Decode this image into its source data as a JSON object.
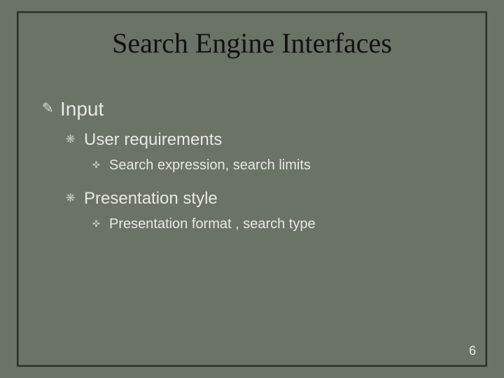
{
  "title": "Search Engine Interfaces",
  "bullets": {
    "lvl1_icon": "✎",
    "lvl2_icon": "❋",
    "lvl3_icon": "✜",
    "input": "Input",
    "user_req": "User requirements",
    "user_req_detail": "Search expression, search limits",
    "pres_style": "Presentation style",
    "pres_style_detail": "Presentation format , search type"
  },
  "page_number": "6"
}
